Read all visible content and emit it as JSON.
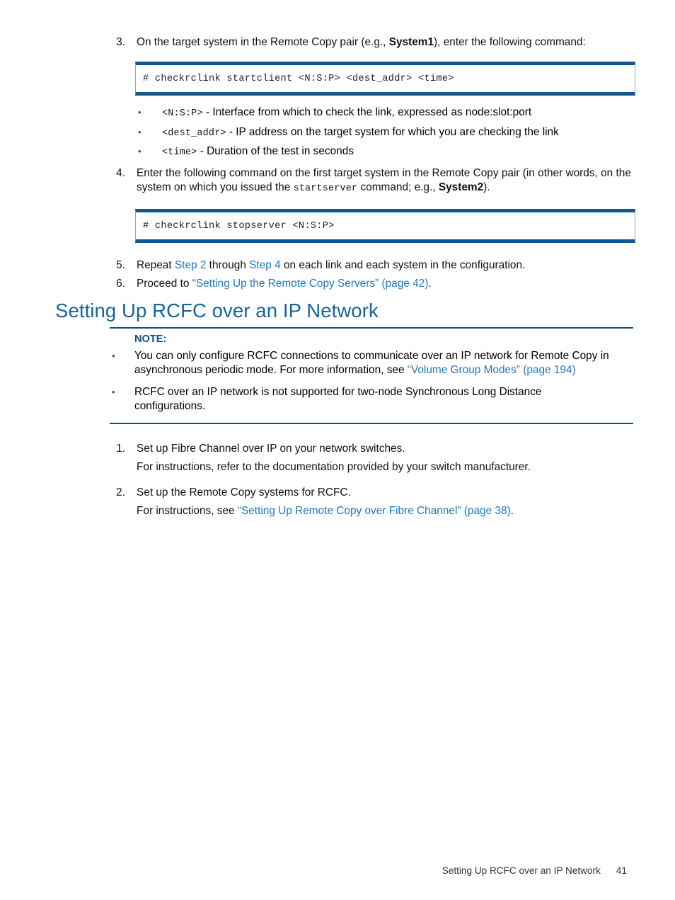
{
  "steps_upper": [
    {
      "num": "3.",
      "text_before": "On the target system in the Remote Copy pair (e.g., ",
      "bold": "System1",
      "text_after": "), enter the following command:",
      "code": "# checkrclink startclient <N:S:P> <dest_addr> <time>"
    },
    {
      "num": "4.",
      "line1": "Enter the following command on the first target system in the Remote Copy pair (in other words,",
      "line2_before": "on the system on which you issued the ",
      "line2_mono": "startserver",
      "line2_mid": " command; e.g., ",
      "line2_bold": "System2",
      "line2_after": ").",
      "code": "# checkrclink stopserver <N:S:P>"
    }
  ],
  "param_bullets": [
    {
      "mono": "<N:S:P>",
      "text": " - Interface from which to check the link, expressed as node:slot:port"
    },
    {
      "mono": "<dest_addr>",
      "text": " - IP address on the target system for which you are checking the link"
    },
    {
      "mono": "<time>",
      "text": " - Duration of the test in seconds"
    }
  ],
  "steps_tail": [
    {
      "num": "5.",
      "pre": "Repeat ",
      "link1": "Step 2",
      "mid": " through ",
      "link2": "Step 4",
      "post": " on each link and each system in the configuration."
    },
    {
      "num": "6.",
      "pre": "Proceed to ",
      "link1": "“Setting Up the Remote Copy Servers” (page 42)",
      "post": "."
    }
  ],
  "section": {
    "heading": "Setting Up RCFC over an IP Network"
  },
  "note": {
    "label": "NOTE:",
    "bullets": [
      {
        "text": "You can only configure RCFC connections to communicate over an IP network for Remote Copy in asynchronous periodic mode. For more information, see ",
        "link": "“Volume Group Modes” (page 194)",
        "tail": ""
      },
      {
        "text": "RCFC over an IP network is not supported for two-node Synchronous Long Distance configurations.",
        "link": "",
        "tail": ""
      }
    ]
  },
  "lower_steps": [
    {
      "num": "1.",
      "title": "Set up Fibre Channel over IP on your network switches.",
      "sub_pre": "For instructions, refer to the documentation provided by your switch manufacturer.",
      "sub_link": "",
      "sub_post": ""
    },
    {
      "num": "2.",
      "title": "Set up the Remote Copy systems for RCFC.",
      "sub_pre": "For instructions, see ",
      "sub_link": "“Setting Up Remote Copy over Fibre Channel” (page 38)",
      "sub_post": "."
    }
  ],
  "footer": {
    "title": "Setting Up RCFC over an IP Network",
    "page": "41"
  },
  "colors": {
    "heading_blue": "#14659c",
    "link_blue": "#2277bb",
    "rule_blue": "#0f4f84",
    "code_border": "#12578f"
  }
}
